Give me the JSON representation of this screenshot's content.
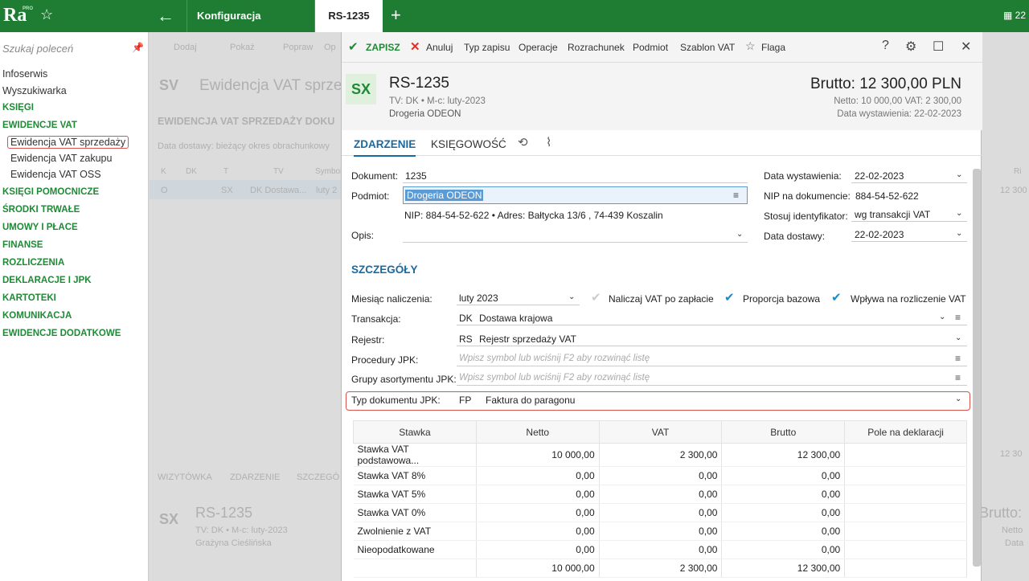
{
  "app": {
    "logo": "Ra",
    "logo_badge": "PRO",
    "tab_config": "Konfiguracja systemu",
    "tab_doc": "RS-1235",
    "top_right": "22"
  },
  "sidebar": {
    "search_placeholder": "Szukaj poleceń",
    "items": [
      "Infoserwis",
      "Wyszukiwarka"
    ],
    "sections": [
      "KSIĘGI",
      "EWIDENCJE VAT",
      "KSIĘGI POMOCNICZE",
      "ŚRODKI TRWAŁE",
      "UMOWY I PŁACE",
      "FINANSE",
      "ROZLICZENIA",
      "DEKLARACJE I JPK",
      "KARTOTEKI",
      "KOMUNIKACJA",
      "EWIDENCJE DODATKOWE"
    ],
    "sub_items": [
      "Ewidencja VAT sprzedaży",
      "Ewidencja VAT zakupu",
      "Ewidencja VAT OSS"
    ]
  },
  "background": {
    "toolbar": [
      "Dodaj",
      "Pokaż",
      "Popraw",
      "Op"
    ],
    "title_badge": "SV",
    "title": "Ewidencja VAT sprze",
    "subtitle": "EWIDENCJA VAT SPRZEDAŻY DOKU",
    "filter": "Data dostawy: bieżący okres obrachunkowy",
    "cols": [
      "K",
      "DK",
      "T",
      "TV",
      "Symbol"
    ],
    "row": [
      "O",
      "SX",
      "DK Dostawa...",
      "luty 2"
    ],
    "right_vals": [
      "Ri",
      "12 300",
      "12 30"
    ],
    "bottom_tabs": [
      "WIZYTÓWKA",
      "ZDARZENIE",
      "SZCZEGÓ"
    ],
    "bottom_badge": "SX",
    "bottom_doc": "RS-1235",
    "bottom_sub": "TV: DK • M-c: luty-2023",
    "bottom_name": "Grażyna Cieślińska",
    "bottom_right": [
      "Brutto:",
      "Netto",
      "Data"
    ]
  },
  "toolbar": {
    "save": "ZAPISZ",
    "cancel": "Anuluj",
    "type": "Typ zapisu",
    "ops": "Operacje",
    "settle": "Rozrachunek",
    "subject": "Podmiot",
    "template": "Szablon VAT",
    "flag": "Flaga"
  },
  "header": {
    "badge": "SX",
    "doc": "RS-1235",
    "tv": "TV: DK  •  M-c: luty-2023",
    "name": "Drogeria ODEON",
    "brutto": "Brutto: 12 300,00 PLN",
    "netto_vat": "Netto: 10 000,00 VAT: 2 300,00",
    "date": "Data wystawienia: 22-02-2023"
  },
  "tabs": {
    "event": "ZDARZENIE",
    "accounting": "KSIĘGOWOŚĆ"
  },
  "form": {
    "doc_label": "Dokument:",
    "doc_value": "1235",
    "subject_label": "Podmiot:",
    "subject_value": "Drogeria ODEON",
    "nip_line": "NIP:  884-54-52-622  •  Adres:  Bałtycka  13/6 , 74-439 Koszalin",
    "desc_label": "Opis:",
    "issue_label": "Data wystawienia:",
    "issue_value": "22-02-2023",
    "nipdoc_label": "NIP na dokumencie:",
    "nipdoc_value": "884-54-52-622",
    "ident_label": "Stosuj identyfikator:",
    "ident_value": "wg transakcji VAT",
    "delivery_label": "Data dostawy:",
    "delivery_value": "22-02-2023"
  },
  "details": {
    "title": "SZCZEGÓŁY",
    "month_label": "Miesiąc naliczenia:",
    "month_value": "luty 2023",
    "chk1": "Naliczaj VAT po zapłacie",
    "chk2": "Proporcja bazowa",
    "chk3": "Wpływa na rozliczenie VAT",
    "trans_label": "Transakcja:",
    "trans_code": "DK",
    "trans_value": "Dostawa krajowa",
    "reg_label": "Rejestr:",
    "reg_code": "RS",
    "reg_value": "Rejestr sprzedaży VAT",
    "proc_label": "Procedury JPK:",
    "placeholder": "Wpisz symbol lub wciśnij F2 aby rozwinąć listę",
    "groups_label": "Grupy asortymentu JPK:",
    "jpk_label": "Typ dokumentu JPK:",
    "jpk_code": "FP",
    "jpk_value": "Faktura do paragonu"
  },
  "table": {
    "headers": [
      "Stawka",
      "Netto",
      "VAT",
      "Brutto",
      "Pole na deklaracji"
    ],
    "rows": [
      [
        "Stawka VAT podstawowa...",
        "10 000,00",
        "2 300,00",
        "12 300,00",
        ""
      ],
      [
        "Stawka VAT 8%",
        "0,00",
        "0,00",
        "0,00",
        ""
      ],
      [
        "Stawka VAT 5%",
        "0,00",
        "0,00",
        "0,00",
        ""
      ],
      [
        "Stawka VAT 0%",
        "0,00",
        "0,00",
        "0,00",
        ""
      ],
      [
        "Zwolnienie z VAT",
        "0,00",
        "0,00",
        "0,00",
        ""
      ],
      [
        "Nieopodatkowane",
        "0,00",
        "0,00",
        "0,00",
        ""
      ]
    ],
    "sum": [
      "",
      "10 000,00",
      "2 300,00",
      "12 300,00",
      ""
    ]
  },
  "colors": {
    "brand": "#1e7d33",
    "accent": "#1a6aa0",
    "highlight": "#d9534f"
  }
}
